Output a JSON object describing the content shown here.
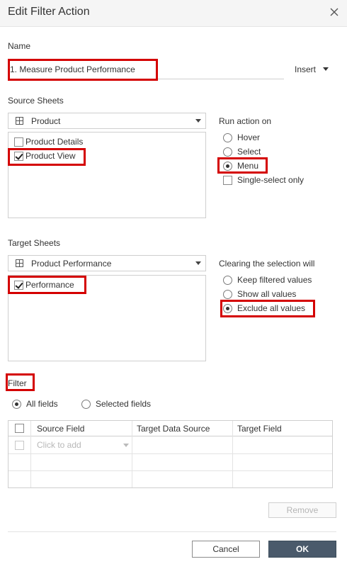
{
  "dialog": {
    "title": "Edit Filter Action"
  },
  "name": {
    "label": "Name",
    "value": "1. Measure Product Performance",
    "insert_label": "Insert"
  },
  "source": {
    "label": "Source Sheets",
    "dropdown": "Product",
    "items": [
      {
        "label": "Product Details",
        "checked": false
      },
      {
        "label": "Product View",
        "checked": true
      }
    ]
  },
  "run_action": {
    "label": "Run action on",
    "options": [
      "Hover",
      "Select",
      "Menu"
    ],
    "selected": "Menu",
    "single_select_label": "Single-select only"
  },
  "target": {
    "label": "Target Sheets",
    "dropdown": "Product Performance",
    "items": [
      {
        "label": "Performance",
        "checked": true
      }
    ]
  },
  "clearing": {
    "label": "Clearing the selection will",
    "options": [
      "Keep filtered values",
      "Show all values",
      "Exclude all values"
    ],
    "selected": "Exclude all values"
  },
  "filter": {
    "label": "Filter",
    "options": [
      "All fields",
      "Selected fields"
    ],
    "selected": "All fields",
    "columns": [
      "Source Field",
      "Target Data Source",
      "Target Field"
    ],
    "add_placeholder": "Click to add"
  },
  "buttons": {
    "remove": "Remove",
    "cancel": "Cancel",
    "ok": "OK"
  },
  "colors": {
    "highlight": "#d40000",
    "ok_button": "#4a5a6b"
  }
}
